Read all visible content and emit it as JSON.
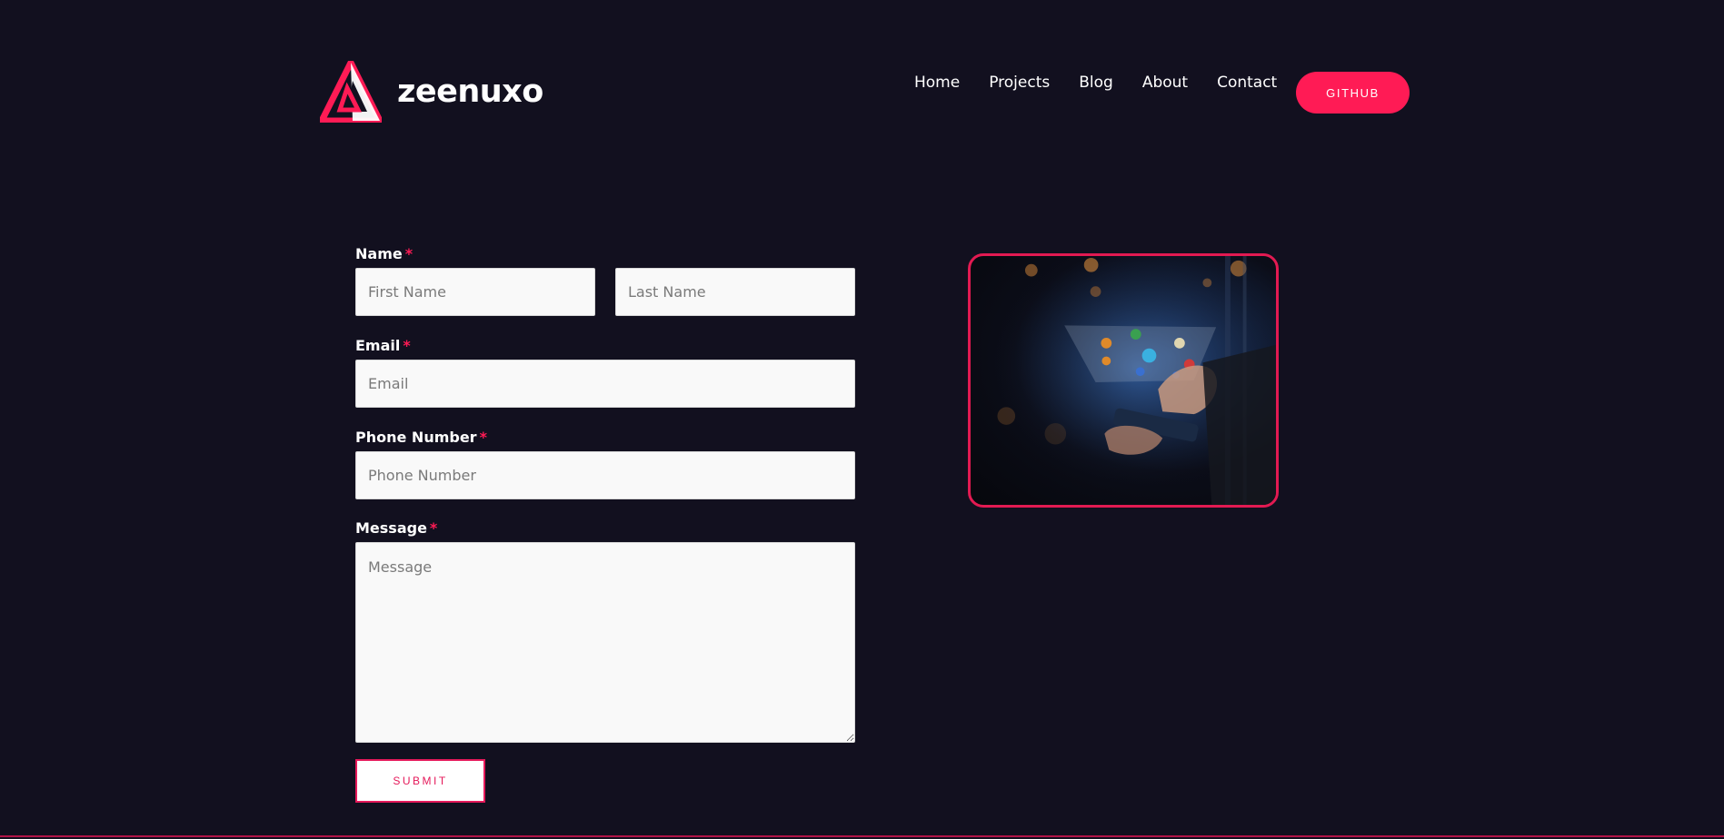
{
  "brand": {
    "name": "zeenuxo",
    "accent": "#ff1b55",
    "background": "#12101f"
  },
  "nav": {
    "items": [
      {
        "label": "Home"
      },
      {
        "label": "Projects"
      },
      {
        "label": "Blog"
      },
      {
        "label": "About"
      },
      {
        "label": "Contact"
      }
    ],
    "cta_label": "GITHUB"
  },
  "form": {
    "required_marker": "*",
    "name": {
      "label": "Name",
      "first_placeholder": "First Name",
      "last_placeholder": "Last Name"
    },
    "email": {
      "label": "Email",
      "placeholder": "Email"
    },
    "phone": {
      "label": "Phone Number",
      "placeholder": "Phone Number"
    },
    "message": {
      "label": "Message",
      "placeholder": "Message"
    },
    "submit_label": "SUBMIT"
  },
  "image": {
    "icon": "hand-holding-phone-with-floating-app-icons"
  }
}
